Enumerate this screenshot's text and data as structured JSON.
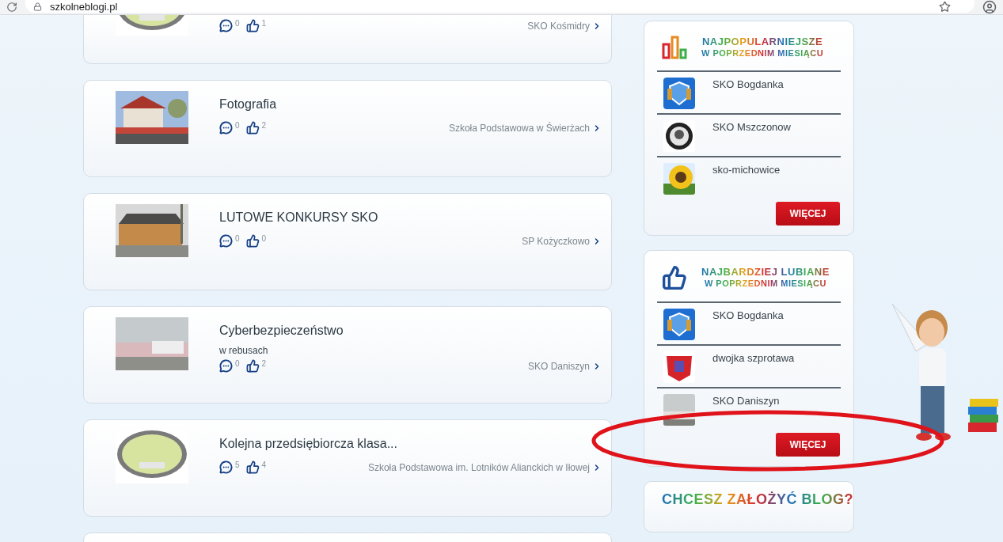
{
  "browser": {
    "url": "szkolneblogi.pl"
  },
  "posts": [
    {
      "comments": "0",
      "likes": "1",
      "author": "SKO Kośmidry"
    },
    {
      "title": "Fotografia",
      "comments": "0",
      "likes": "2",
      "author": "Szkoła Podstawowa w Świerżach"
    },
    {
      "title": "LUTOWE KONKURSY SKO",
      "comments": "0",
      "likes": "0",
      "author": "SP Kożyczkowo"
    },
    {
      "title": "Cyberbezpieczeństwo",
      "subtitle": "w rebusach",
      "comments": "0",
      "likes": "2",
      "author": "SKO Daniszyn"
    },
    {
      "title": "Kolejna przedsiębiorcza klasa...",
      "comments": "5",
      "likes": "4",
      "author": "Szkoła Podstawowa im. Lotników Alianckich w Iłowej"
    }
  ],
  "panels": [
    {
      "kind": "bars",
      "title": "NAJPOPULARNIEJSZE",
      "subtitle": "W POPRZEDNIM MIESIĄCU",
      "items": [
        {
          "name": "SKO Bogdanka"
        },
        {
          "name": "SKO Mszczonow"
        },
        {
          "name": "sko-michowice"
        }
      ],
      "button": "WIĘCEJ"
    },
    {
      "kind": "thumb",
      "title": "NAJBARDZIEJ LUBIANE",
      "subtitle": "W POPRZEDNIM MIESIĄCU",
      "items": [
        {
          "name": "SKO Bogdanka"
        },
        {
          "name": "dwojka szprotawa"
        },
        {
          "name": "SKO Daniszyn"
        }
      ],
      "button": "WIĘCEJ"
    }
  ],
  "promo": {
    "title": "CHCESZ ZAŁOŻYĆ BLOG?"
  }
}
